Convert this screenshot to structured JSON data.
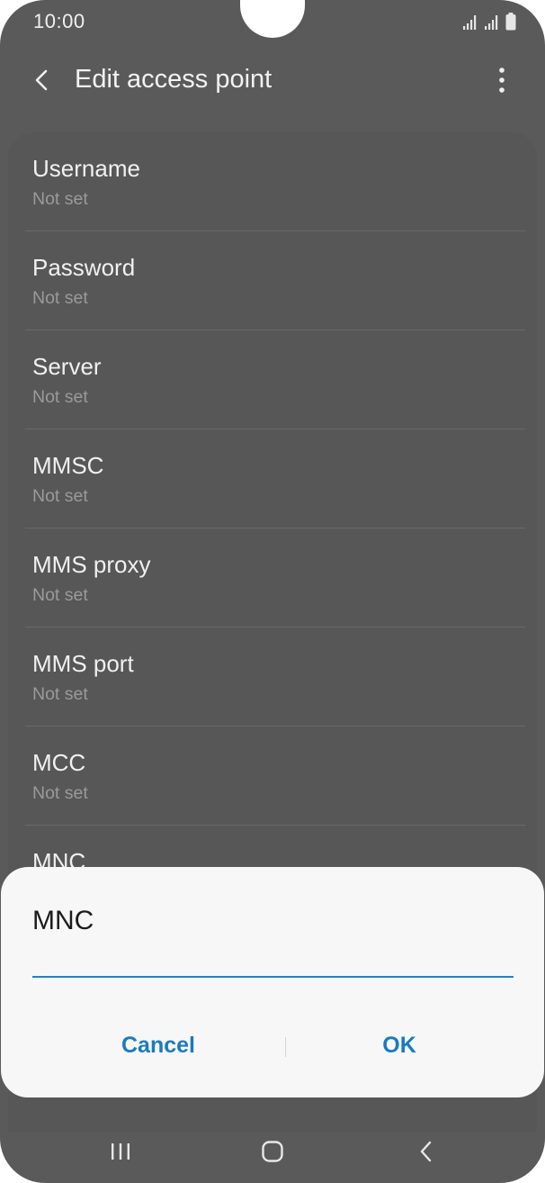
{
  "status_bar": {
    "time": "10:00"
  },
  "app_bar": {
    "title": "Edit access point"
  },
  "settings": {
    "items": [
      {
        "title": "Username",
        "value": "Not set"
      },
      {
        "title": "Password",
        "value": "Not set"
      },
      {
        "title": "Server",
        "value": "Not set"
      },
      {
        "title": "MMSC",
        "value": "Not set"
      },
      {
        "title": "MMS proxy",
        "value": "Not set"
      },
      {
        "title": "MMS port",
        "value": "Not set"
      },
      {
        "title": "MCC",
        "value": "Not set"
      },
      {
        "title": "MNC",
        "value": ""
      }
    ]
  },
  "dialog": {
    "title": "MNC",
    "input_value": "",
    "cancel_label": "Cancel",
    "ok_label": "OK"
  },
  "icons": {
    "back": "back-arrow-icon",
    "more": "more-vertical-icon",
    "signal": "signal-icon",
    "battery": "battery-icon",
    "recents": "recents-icon",
    "home": "home-icon",
    "nav_back": "back-icon"
  },
  "colors": {
    "accent": "#1b84c7",
    "scrim_background": "#5a5a5a",
    "dialog_background": "#f7f7f7"
  }
}
